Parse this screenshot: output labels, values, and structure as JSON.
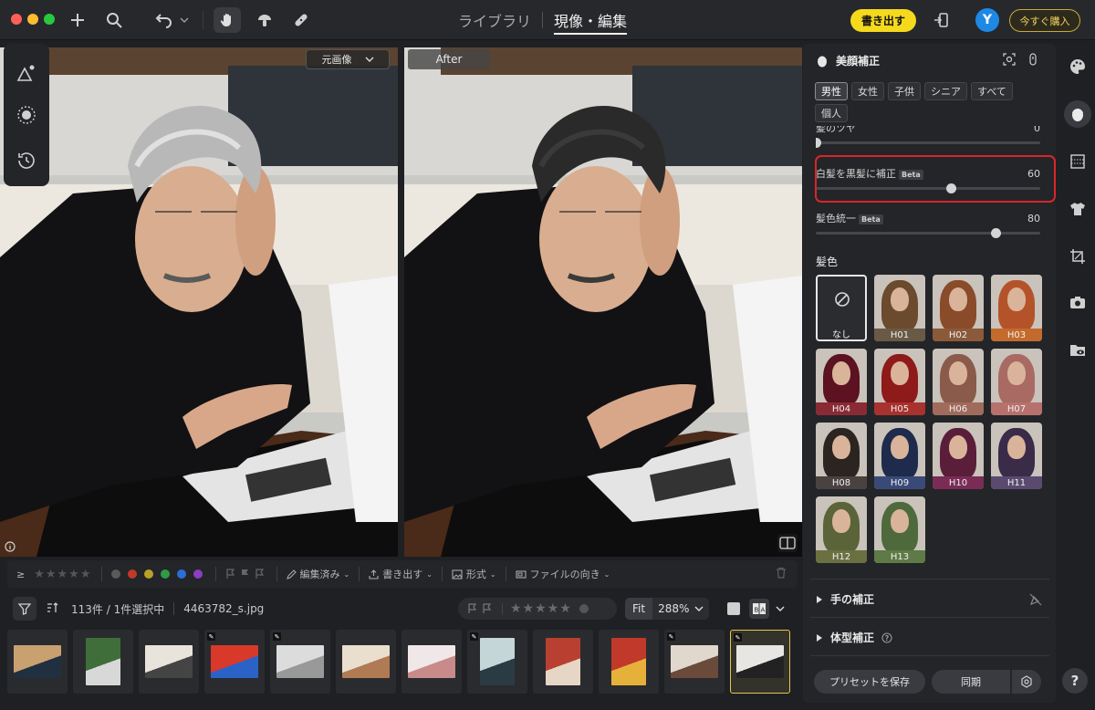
{
  "topbar": {
    "tabs": [
      {
        "label": "ライブラリ",
        "active": false
      },
      {
        "label": "現像・編集",
        "active": true
      }
    ],
    "export_label": "書き出す",
    "avatar_initial": "Y",
    "buy_label": "今すぐ購入",
    "icons": [
      "plus-icon",
      "search-icon",
      "undo-icon",
      "hand-icon",
      "mushroom-icon",
      "bandage-icon",
      "import-icon"
    ]
  },
  "viewer": {
    "before_selector_label": "元画像",
    "after_label": "After"
  },
  "filterbar": {
    "edited_label": "編集済み",
    "export_label": "書き出す",
    "format_label": "形式",
    "orientation_label": "ファイルの向き",
    "colors": [
      "#5a5a5a",
      "#c0392b",
      "#b8a128",
      "#2e9c45",
      "#2b6fd6",
      "#8a3fbf"
    ]
  },
  "infobar": {
    "count_label": "113件 / 1件選択中",
    "filename": "4463782_s.jpg",
    "fit_label": "Fit",
    "zoom_label": "288%"
  },
  "filmstrip": {
    "selected_index": 11,
    "thumbs": [
      {
        "edited": false
      },
      {
        "edited": false
      },
      {
        "edited": false
      },
      {
        "edited": true
      },
      {
        "edited": true
      },
      {
        "edited": false
      },
      {
        "edited": false
      },
      {
        "edited": true
      },
      {
        "edited": false
      },
      {
        "edited": false
      },
      {
        "edited": true
      },
      {
        "edited": true
      }
    ]
  },
  "panel": {
    "title": "美顔補正",
    "chips": [
      {
        "label": "男性",
        "active": true
      },
      {
        "label": "女性",
        "active": false
      },
      {
        "label": "子供",
        "active": false
      },
      {
        "label": "シニア",
        "active": false
      },
      {
        "label": "すべて",
        "active": false
      },
      {
        "label": "個人",
        "active": false
      }
    ],
    "partial_slider": {
      "label": "髪のツヤ",
      "value": "0",
      "fraction": 0.0
    },
    "gray_hair_slider": {
      "label": "白髪を黒髪に補正",
      "beta": "Beta",
      "value": "60",
      "fraction": 0.6
    },
    "hair_unify_slider": {
      "label": "髪色統一",
      "beta": "Beta",
      "value": "80",
      "fraction": 0.8
    },
    "hair_color_label": "髪色",
    "swatches": [
      {
        "label": "なし",
        "hair": "",
        "cap": ""
      },
      {
        "label": "H01",
        "hair": "#6b4a2e",
        "cap": "#6a5a45"
      },
      {
        "label": "H02",
        "hair": "#8a4b2a",
        "cap": "#8a5a3a"
      },
      {
        "label": "H03",
        "hair": "#b4532a",
        "cap": "#c46a2d"
      },
      {
        "label": "H04",
        "hair": "#5c1220",
        "cap": "#8a2a34"
      },
      {
        "label": "H05",
        "hair": "#8e1a1a",
        "cap": "#a8322e"
      },
      {
        "label": "H06",
        "hair": "#8a5a4a",
        "cap": "#a06b5c"
      },
      {
        "label": "H07",
        "hair": "#a86a62",
        "cap": "#b7716c"
      },
      {
        "label": "H08",
        "hair": "#2c2420",
        "cap": "#4a4240"
      },
      {
        "label": "H09",
        "hair": "#1e2b4c",
        "cap": "#3a4a78"
      },
      {
        "label": "H10",
        "hair": "#5a1e3a",
        "cap": "#7a2c56"
      },
      {
        "label": "H11",
        "hair": "#3a2b48",
        "cap": "#5a4a70"
      },
      {
        "label": "H12",
        "hair": "#5a6438",
        "cap": "#6a7040"
      },
      {
        "label": "H13",
        "hair": "#4e6a3c",
        "cap": "#5e7a46"
      }
    ],
    "hand_section_label": "手の補正",
    "body_section_label": "体型補正",
    "preset_label": "プリセットを保存",
    "sync_label": "同期"
  },
  "rail": {
    "icons": [
      "palette-icon",
      "face-icon",
      "texture-icon",
      "shirt-icon",
      "crop-icon",
      "camera-icon",
      "folder-eye-icon"
    ],
    "active_index": 1,
    "help_label": "?"
  }
}
